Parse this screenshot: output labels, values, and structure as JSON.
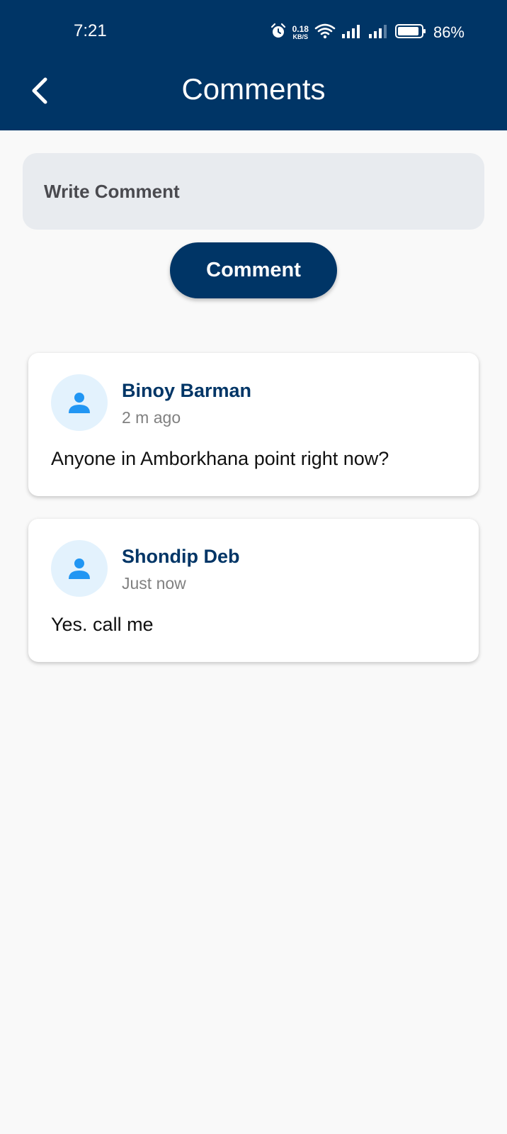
{
  "status_bar": {
    "time": "7:21",
    "net_speed_value": "0.18",
    "net_speed_unit": "KB/S",
    "battery": "86%"
  },
  "header": {
    "title": "Comments",
    "back_icon": "chevron-left-icon"
  },
  "compose": {
    "placeholder": "Write Comment",
    "value": "",
    "button_label": "Comment"
  },
  "comments": [
    {
      "author": "Binoy Barman",
      "time": "2 m ago",
      "text": "Anyone in Amborkhana point right now?",
      "avatar_icon": "person-icon"
    },
    {
      "author": "Shondip Deb",
      "time": "Just now",
      "text": "Yes. call me",
      "avatar_icon": "person-icon"
    }
  ],
  "colors": {
    "primary": "#003566",
    "avatar_bg": "#e3f2fd",
    "avatar_icon": "#2196f3",
    "background": "#f9f9f9"
  }
}
